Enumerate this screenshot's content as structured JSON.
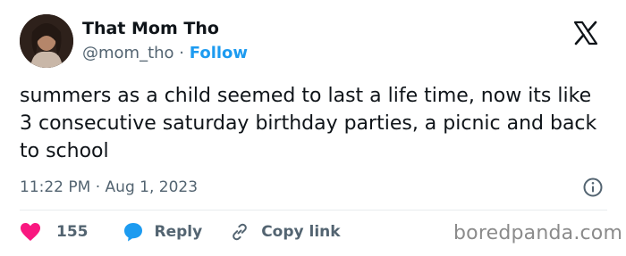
{
  "author": {
    "name": "That Mom Tho",
    "handle": "@mom_tho",
    "separator": "·",
    "follow_label": "Follow"
  },
  "tweet": {
    "text": "summers as a child seemed to last a life time, now its like 3 consecutive saturday birthday parties, a picnic and back to school",
    "time": "11:22 PM",
    "date_separator": "·",
    "date": "Aug 1, 2023"
  },
  "actions": {
    "likes": "155",
    "reply_label": "Reply",
    "copy_link_label": "Copy link"
  },
  "watermark": "boredpanda.com",
  "icons": {
    "logo": "x-logo-icon",
    "info": "info-icon",
    "like": "heart-icon",
    "reply": "speech-bubble-icon",
    "copy": "link-icon"
  },
  "colors": {
    "text": "#0f1419",
    "secondary": "#536471",
    "accent": "#1d9bf0",
    "like": "#f91880"
  }
}
